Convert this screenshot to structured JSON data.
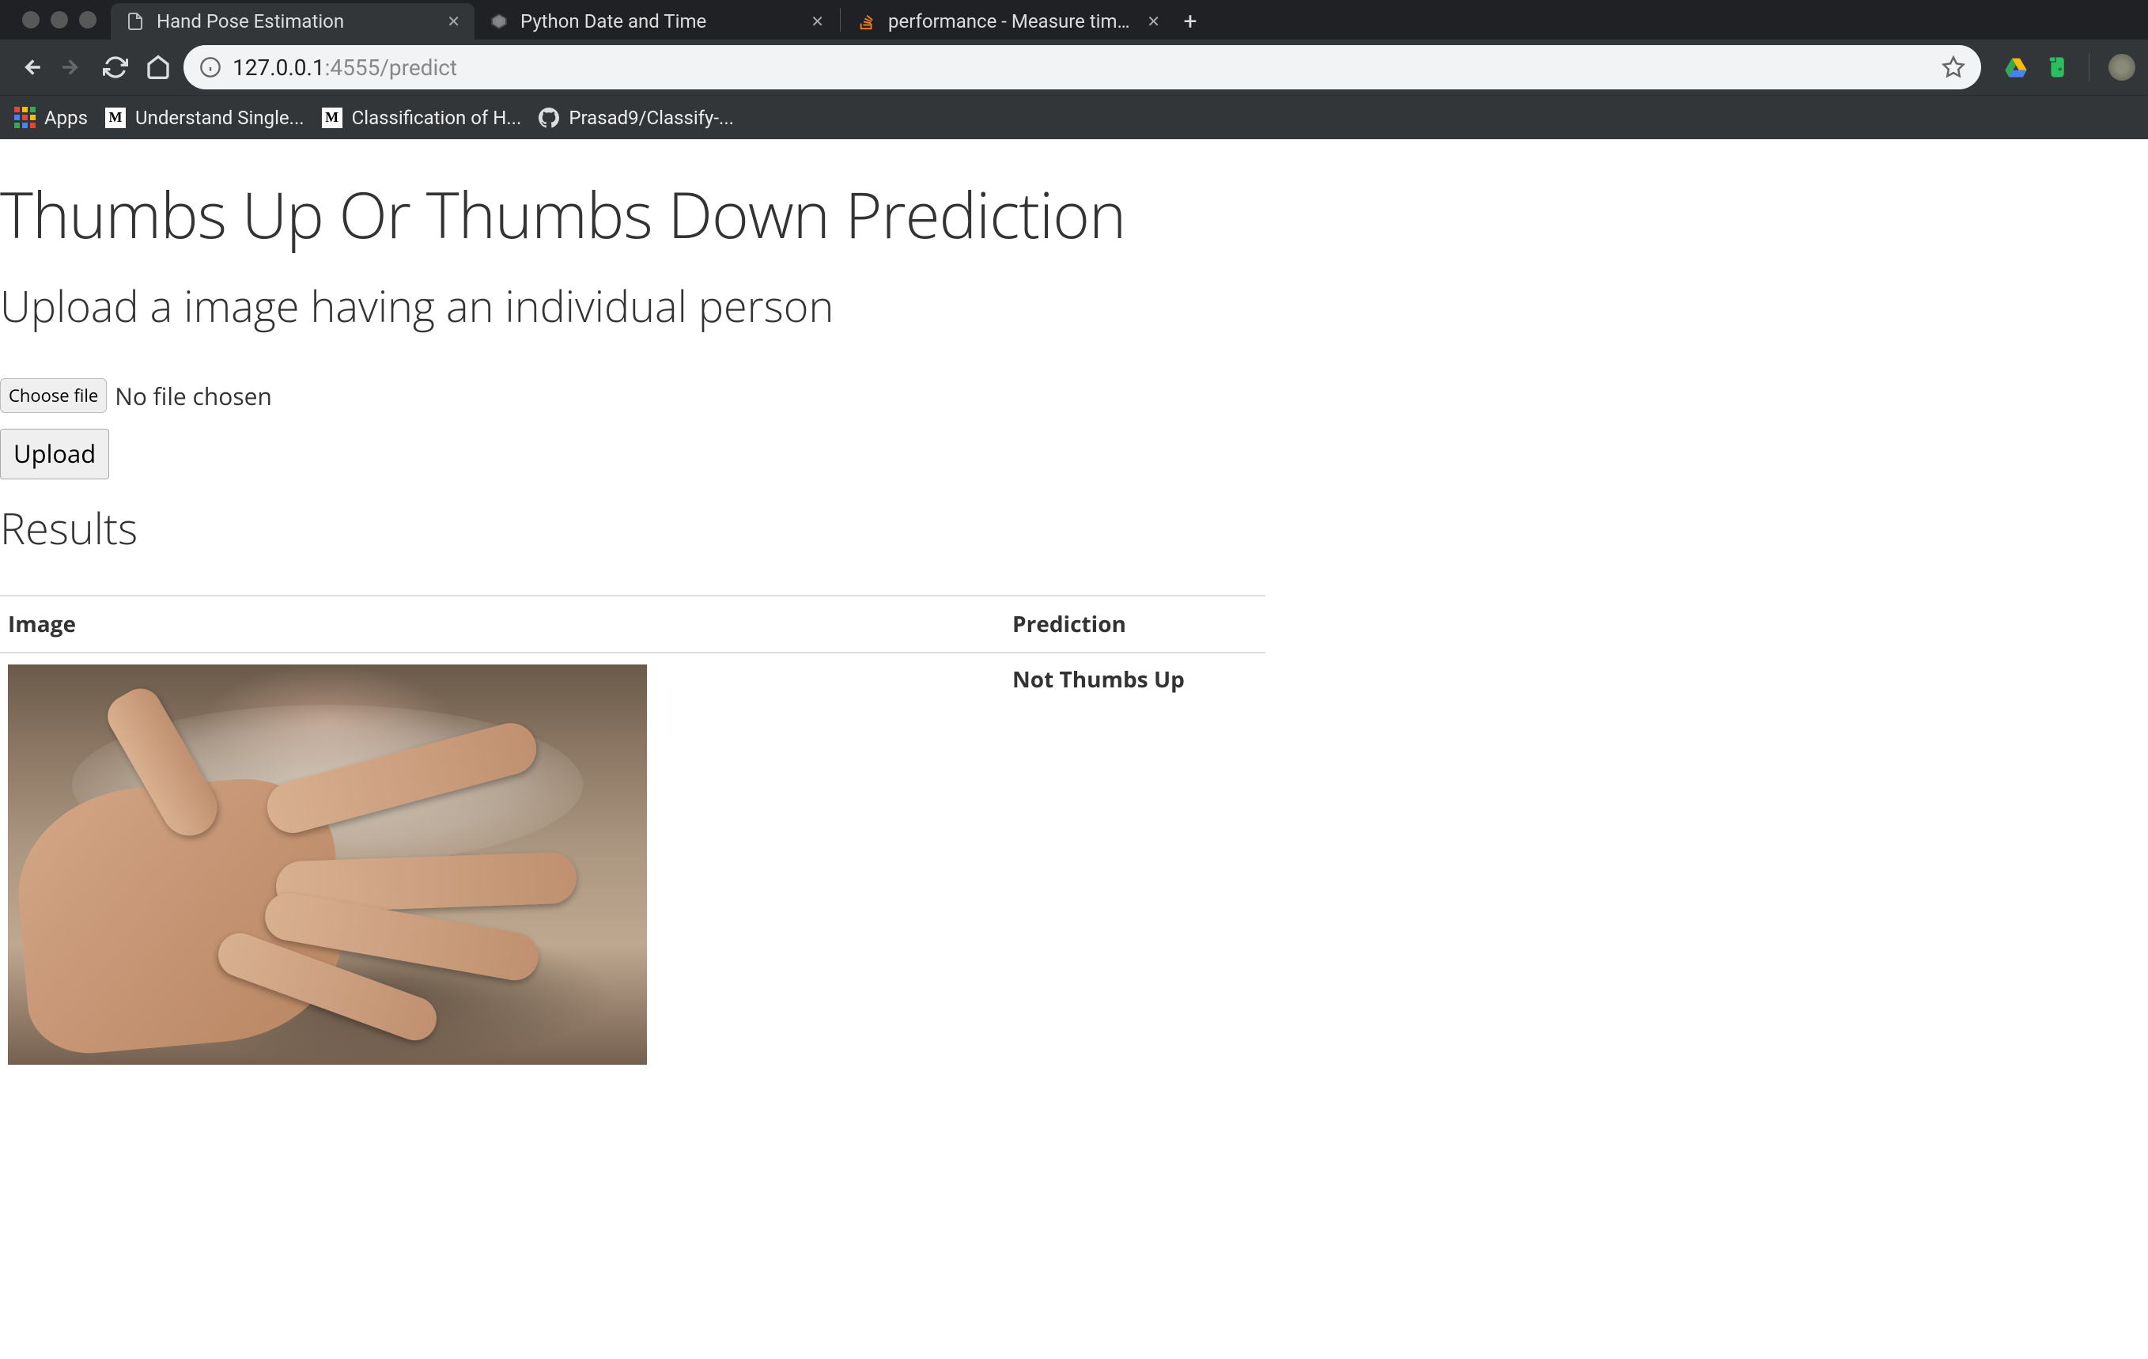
{
  "browser": {
    "tabs": [
      {
        "title": "Hand Pose Estimation",
        "active": true,
        "favicon": "document-icon"
      },
      {
        "title": "Python Date and Time",
        "active": false,
        "favicon": "python-icon"
      },
      {
        "title": "performance - Measure time el",
        "active": false,
        "favicon": "stackoverflow-icon"
      }
    ],
    "url_host": "127.0.0.1",
    "url_port": ":4555",
    "url_path": "/predict",
    "bookmarks": [
      {
        "label": "Apps",
        "icon": "apps-icon"
      },
      {
        "label": "Understand Single...",
        "icon": "medium-icon"
      },
      {
        "label": "Classification of H...",
        "icon": "medium-icon"
      },
      {
        "label": "Prasad9/Classify-...",
        "icon": "github-icon"
      }
    ]
  },
  "page": {
    "h1": "Thumbs Up Or Thumbs Down Prediction",
    "h2": "Upload a image having an individual person",
    "choose_file_label": "Choose file",
    "file_status": "No file chosen",
    "upload_label": "Upload",
    "results_heading": "Results",
    "table_headers": [
      "Image",
      "Prediction"
    ],
    "rows": [
      {
        "prediction": "Not Thumbs Up"
      }
    ]
  }
}
